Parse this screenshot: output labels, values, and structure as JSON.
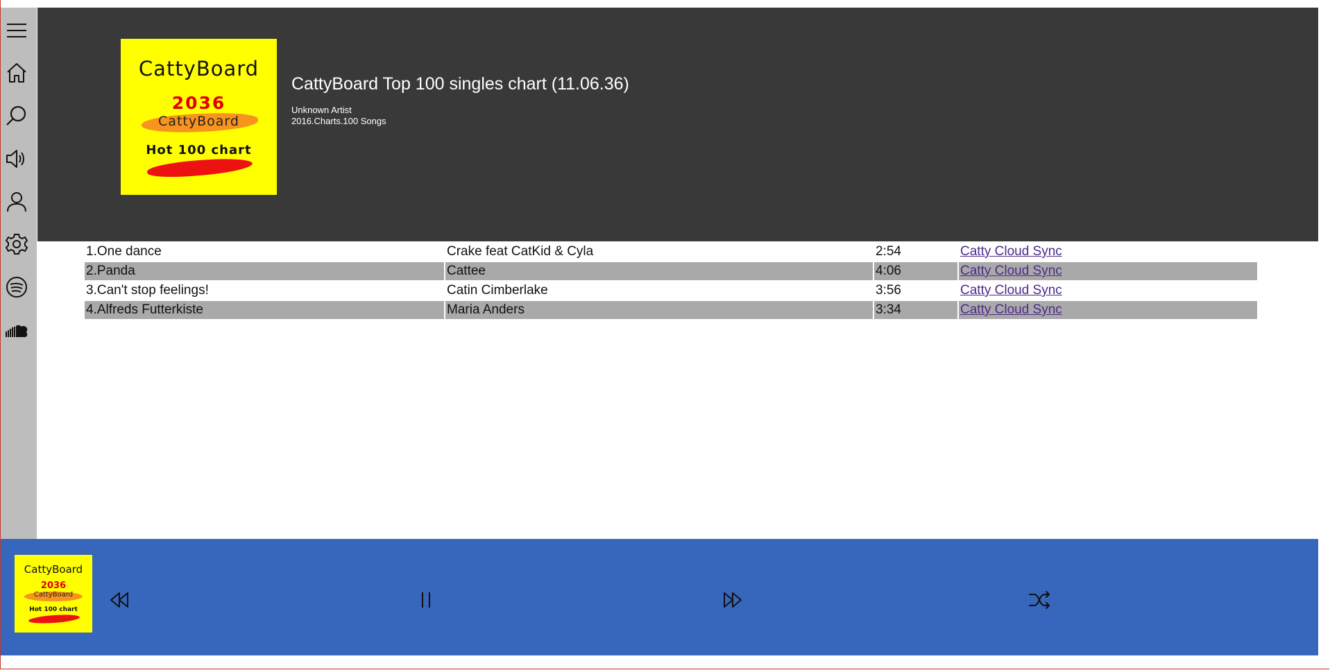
{
  "colors": {
    "sidebar_bg": "#bdbdbd",
    "header_bg": "#3a3939",
    "player_bg": "#3767bc",
    "alt_row_bg": "#a9a9a9",
    "cover_bg": "#ffff00",
    "link": "#4b2a8a"
  },
  "sidebar": {
    "items": [
      {
        "icon": "menu-icon"
      },
      {
        "icon": "home-icon"
      },
      {
        "icon": "search-icon"
      },
      {
        "icon": "speaker-icon"
      },
      {
        "icon": "user-icon"
      },
      {
        "icon": "gear-icon"
      },
      {
        "icon": "spotify-icon"
      },
      {
        "icon": "soundcloud-icon"
      }
    ]
  },
  "album": {
    "cover": {
      "brand": "CattyBoard",
      "year": "2036",
      "brand2": "CattyBoard",
      "hot": "Hot 100 chart"
    },
    "title": "CattyBoard Top 100 singles chart (11.06.36)",
    "artist": "Unknown Artist",
    "meta": "2016.Charts.100 Songs"
  },
  "tracks": [
    {
      "title": "1.One dance",
      "artist": "Crake feat CatKid & Cyla",
      "duration": "2:54",
      "link": "Catty Cloud Sync"
    },
    {
      "title": "2.Panda",
      "artist": "Cattee",
      "duration": "4:06",
      "link": "Catty Cloud Sync"
    },
    {
      "title": "3.Can't stop feelings!",
      "artist": "Catin Cimberlake",
      "duration": "3:56",
      "link": "Catty Cloud Sync"
    },
    {
      "title": "4.Alfreds Futterkiste",
      "artist": "Maria Anders",
      "duration": "3:34",
      "link": "Catty Cloud Sync"
    }
  ],
  "player": {
    "controls": [
      {
        "icon": "rewind-icon"
      },
      {
        "icon": "pause-icon"
      },
      {
        "icon": "fast-forward-icon"
      },
      {
        "icon": "shuffle-icon"
      }
    ]
  }
}
